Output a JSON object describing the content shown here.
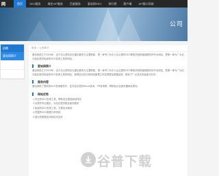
{
  "header": {
    "logo": "网",
    "nav": [
      "首页",
      "SEO服务",
      "",
      "域名VIP服务",
      "百度服务",
      "",
      "爱站网SEO",
      "排行榜",
      "客户端",
      "API接口导航"
    ]
  },
  "banner": {
    "text": "公司"
  },
  "sidebar": {
    "title": "招聘",
    "items": [
      "爱站网简介",
      "",
      ""
    ]
  },
  "content": {
    "breadcrumb": "首页 > 公司简介",
    "intro": "爱站网成立于2009年，全方位以提供站长建站服务为主要职能，是一家专门为中小企业提供SEO等相关网络营销服务的专业网站，是第一家为广大站长朋友提供免费的SEO查询工具的网站。",
    "sections": [
      {
        "title": "爱站网简介",
        "text": "爱站网成立于2009年，全方位以提供站长建站服务为主要职能，是一家专门为中小企业提供SEO等相关网络营销服务的专业网站，是第一家为广大站长朋友提供免费的SEO查询工具的网站，使得站长的日常网站管理工作变得更加便捷高效，受到了广大站长的喜爱与好评。"
      },
      {
        "title": "服务内容",
        "text": "爱站网除了提供的SEO查询服务外，还为站长提供Whois查询、PR查询等，帮助站长全面掌握网站情况。"
      },
      {
        "title": "网站优势",
        "items": [
          "1.专业的SEO查询工具，帮助站长提高网站排名",
          "2.优秀的专业团队，为站长提供更全面的服务",
          "3.免费的SEO查询工具，方便站长使用",
          "4.完整的SEO数据分析系统",
          "5.强大的数据支持和技术支持"
        ]
      }
    ]
  },
  "watermark": {
    "text": "谷普下载"
  },
  "colors": {
    "accent": "#1f78d1",
    "topbar": "#272727"
  }
}
